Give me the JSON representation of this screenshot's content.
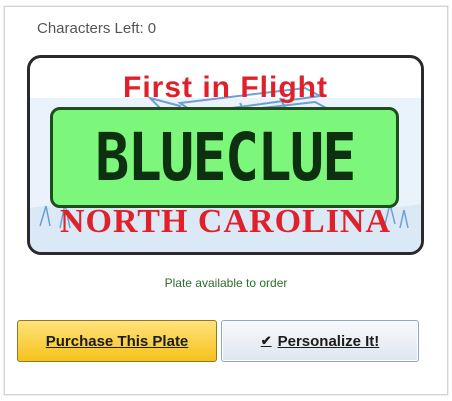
{
  "counter": {
    "label": "Characters Left:",
    "value": "0"
  },
  "plate": {
    "top_text": "First in Flight",
    "bottom_text": "NORTH CAROLINA",
    "plate_text": "BLUECLUE",
    "status": "Plate available to order"
  },
  "buttons": {
    "purchase": "Purchase This Plate",
    "personalize": "Personalize It!",
    "check_icon": "check-icon"
  },
  "colors": {
    "plate_red": "#e0202a",
    "overlay_green": "#7cf77c",
    "purchase_yellow": "#f6c21b"
  }
}
